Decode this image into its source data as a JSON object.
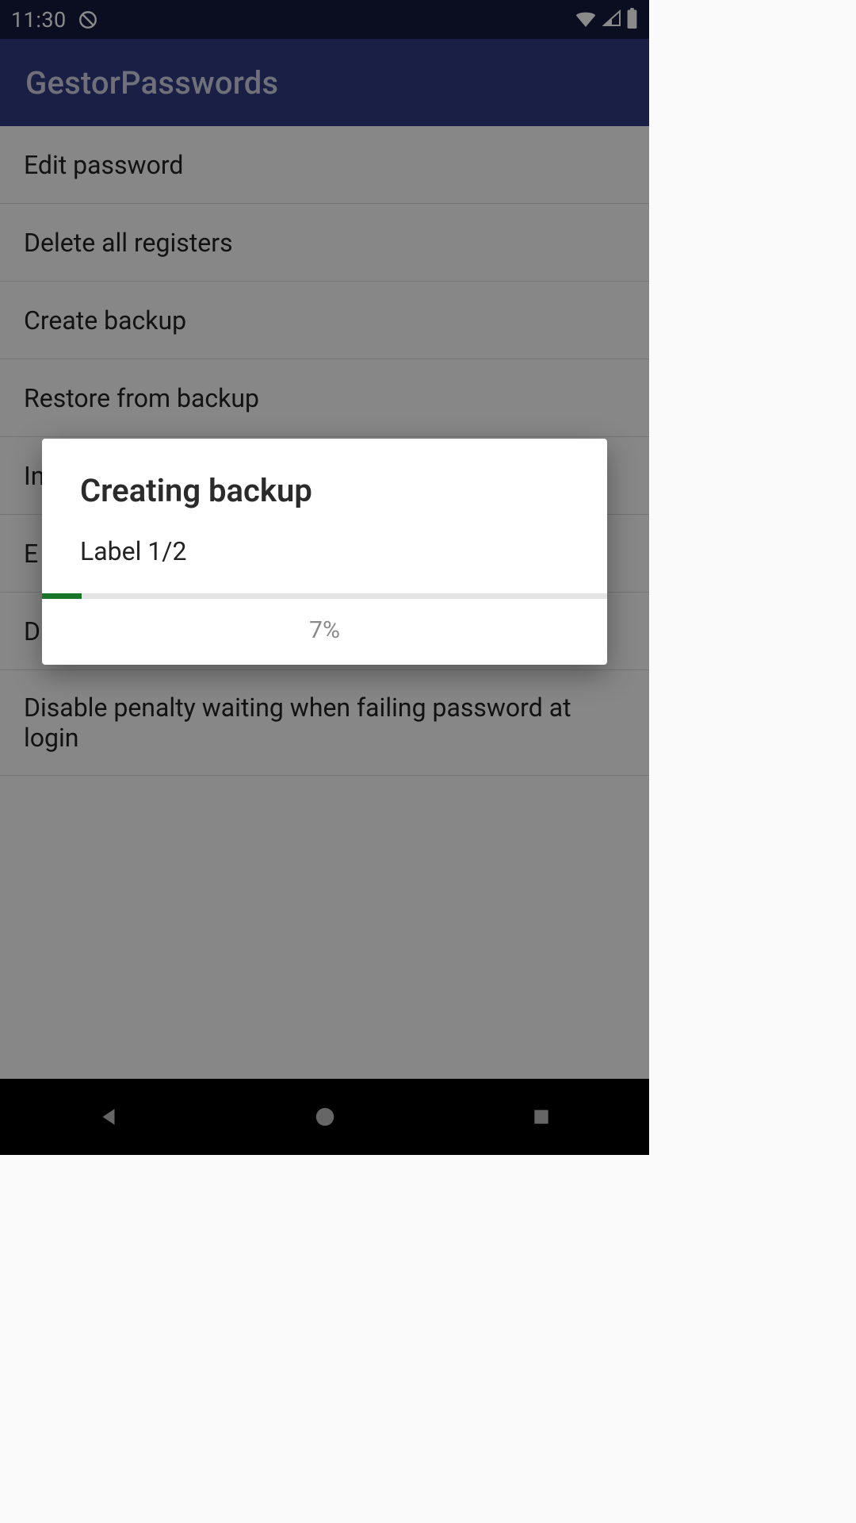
{
  "status": {
    "time": "11:30"
  },
  "app": {
    "title": "GestorPasswords"
  },
  "menu": {
    "items": [
      "Edit password",
      "Delete all registers",
      "Create backup",
      "Restore from backup",
      "In",
      "E",
      "D",
      "Disable penalty waiting when failing password at login"
    ]
  },
  "dialog": {
    "title": "Creating backup",
    "subtitle": "Label 1/2",
    "progress_percent": 7,
    "progress_label": "7%"
  }
}
